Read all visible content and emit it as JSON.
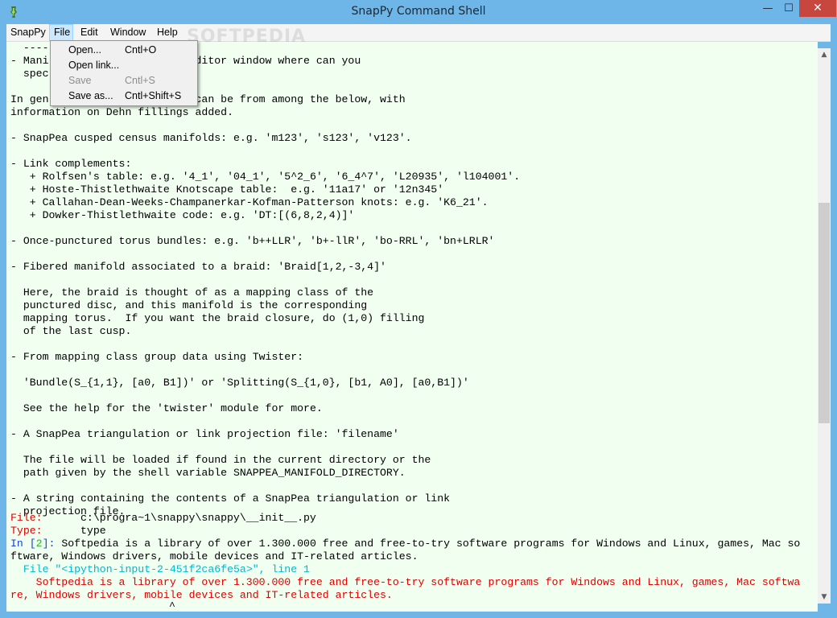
{
  "window": {
    "title": "SnapPy Command Shell",
    "controls": {
      "minimize": "—",
      "maximize": "☐",
      "close": "✕"
    },
    "accent_color": "#6fb6e8"
  },
  "menubar": {
    "items": [
      {
        "label": "SnapPy",
        "active": false
      },
      {
        "label": "File",
        "active": true
      },
      {
        "label": "Edit",
        "active": false
      },
      {
        "label": "Window",
        "active": false
      },
      {
        "label": "Help",
        "active": false
      }
    ]
  },
  "file_menu": {
    "items": [
      {
        "label": "Open...",
        "shortcut": "Cntl+O",
        "enabled": true
      },
      {
        "label": "Open link...",
        "shortcut": "",
        "enabled": true
      },
      {
        "label": "Save",
        "shortcut": "Cntl+S",
        "enabled": false
      },
      {
        "label": "Save as...",
        "shortcut": "Cntl+Shift+S",
        "enabled": true
      }
    ]
  },
  "watermark": "SOFTPEDIA",
  "console": {
    "lines": [
      {
        "text": "  ----",
        "color": "black"
      },
      {
        "text": "- Mani                       ditor window where can you",
        "color": "black"
      },
      {
        "text": "  spec",
        "color": "black"
      },
      {
        "text": "",
        "color": "black"
      },
      {
        "text": "In gen                       can be from among the below, with",
        "color": "black"
      },
      {
        "text": "information on Dehn fillings added.",
        "color": "black"
      },
      {
        "text": "",
        "color": "black"
      },
      {
        "text": "- SnapPea cusped census manifolds: e.g. 'm123', 's123', 'v123'.",
        "color": "black"
      },
      {
        "text": "",
        "color": "black"
      },
      {
        "text": "- Link complements:",
        "color": "black"
      },
      {
        "text": "   + Rolfsen's table: e.g. '4_1', '04_1', '5^2_6', '6_4^7', 'L20935', 'l104001'.",
        "color": "black"
      },
      {
        "text": "   + Hoste-Thistlethwaite Knotscape table:  e.g. '11a17' or '12n345'",
        "color": "black"
      },
      {
        "text": "   + Callahan-Dean-Weeks-Champanerkar-Kofman-Patterson knots: e.g. 'K6_21'.",
        "color": "black"
      },
      {
        "text": "   + Dowker-Thistlethwaite code: e.g. 'DT:[(6,8,2,4)]'",
        "color": "black"
      },
      {
        "text": "",
        "color": "black"
      },
      {
        "text": "- Once-punctured torus bundles: e.g. 'b++LLR', 'b+-llR', 'bo-RRL', 'bn+LRLR'",
        "color": "black"
      },
      {
        "text": "",
        "color": "black"
      },
      {
        "text": "- Fibered manifold associated to a braid: 'Braid[1,2,-3,4]'",
        "color": "black"
      },
      {
        "text": "",
        "color": "black"
      },
      {
        "text": "  Here, the braid is thought of as a mapping class of the",
        "color": "black"
      },
      {
        "text": "  punctured disc, and this manifold is the corresponding",
        "color": "black"
      },
      {
        "text": "  mapping torus.  If you want the braid closure, do (1,0) filling",
        "color": "black"
      },
      {
        "text": "  of the last cusp.",
        "color": "black"
      },
      {
        "text": "",
        "color": "black"
      },
      {
        "text": "- From mapping class group data using Twister:",
        "color": "black"
      },
      {
        "text": "",
        "color": "black"
      },
      {
        "text": "  'Bundle(S_{1,1}, [a0, B1])' or 'Splitting(S_{1,0}, [b1, A0], [a0,B1])'",
        "color": "black"
      },
      {
        "text": "",
        "color": "black"
      },
      {
        "text": "  See the help for the 'twister' module for more.",
        "color": "black"
      },
      {
        "text": "",
        "color": "black"
      },
      {
        "text": "- A SnapPea triangulation or link projection file: 'filename'",
        "color": "black"
      },
      {
        "text": "",
        "color": "black"
      },
      {
        "text": "  The file will be loaded if found in the current directory or the",
        "color": "black"
      },
      {
        "text": "  path given by the shell variable SNAPPEA_MANIFOLD_DIRECTORY.",
        "color": "black"
      },
      {
        "text": "",
        "color": "black"
      },
      {
        "text": "- A string containing the contents of a SnapPea triangulation or link",
        "color": "black"
      },
      {
        "text": "  projection file.",
        "color": "black"
      }
    ],
    "info_lines": [
      {
        "key": "File:",
        "value": "c:\\progra~1\\snappy\\snappy\\__init__.py"
      },
      {
        "key": "Type:",
        "value": "type"
      }
    ],
    "prompt": {
      "in_label": "In [",
      "number": "2",
      "close": "]: ",
      "text": "Softpedia is a library of over 1.300.000 free and free-to-try software programs for Windows and Linux, games, Mac so"
    },
    "continuation": "ftware, Windows drivers, mobile devices and IT-related articles.",
    "traceback": {
      "file_label": "  File ",
      "file_name": "\"<ipython-input-2-451f2ca6fe5a>\"",
      "line_part": ", line 1"
    },
    "error_line_1": "    Softpedia is a library of over 1.300.000 free and free-to-try software programs for Windows and Linux, games, Mac softwa",
    "error_line_2": "re, Windows drivers, mobile devices and IT-related articles.",
    "caret": "^"
  },
  "scrollbar": {
    "up": "▲",
    "down": "▼",
    "position_fraction": 0.38
  }
}
